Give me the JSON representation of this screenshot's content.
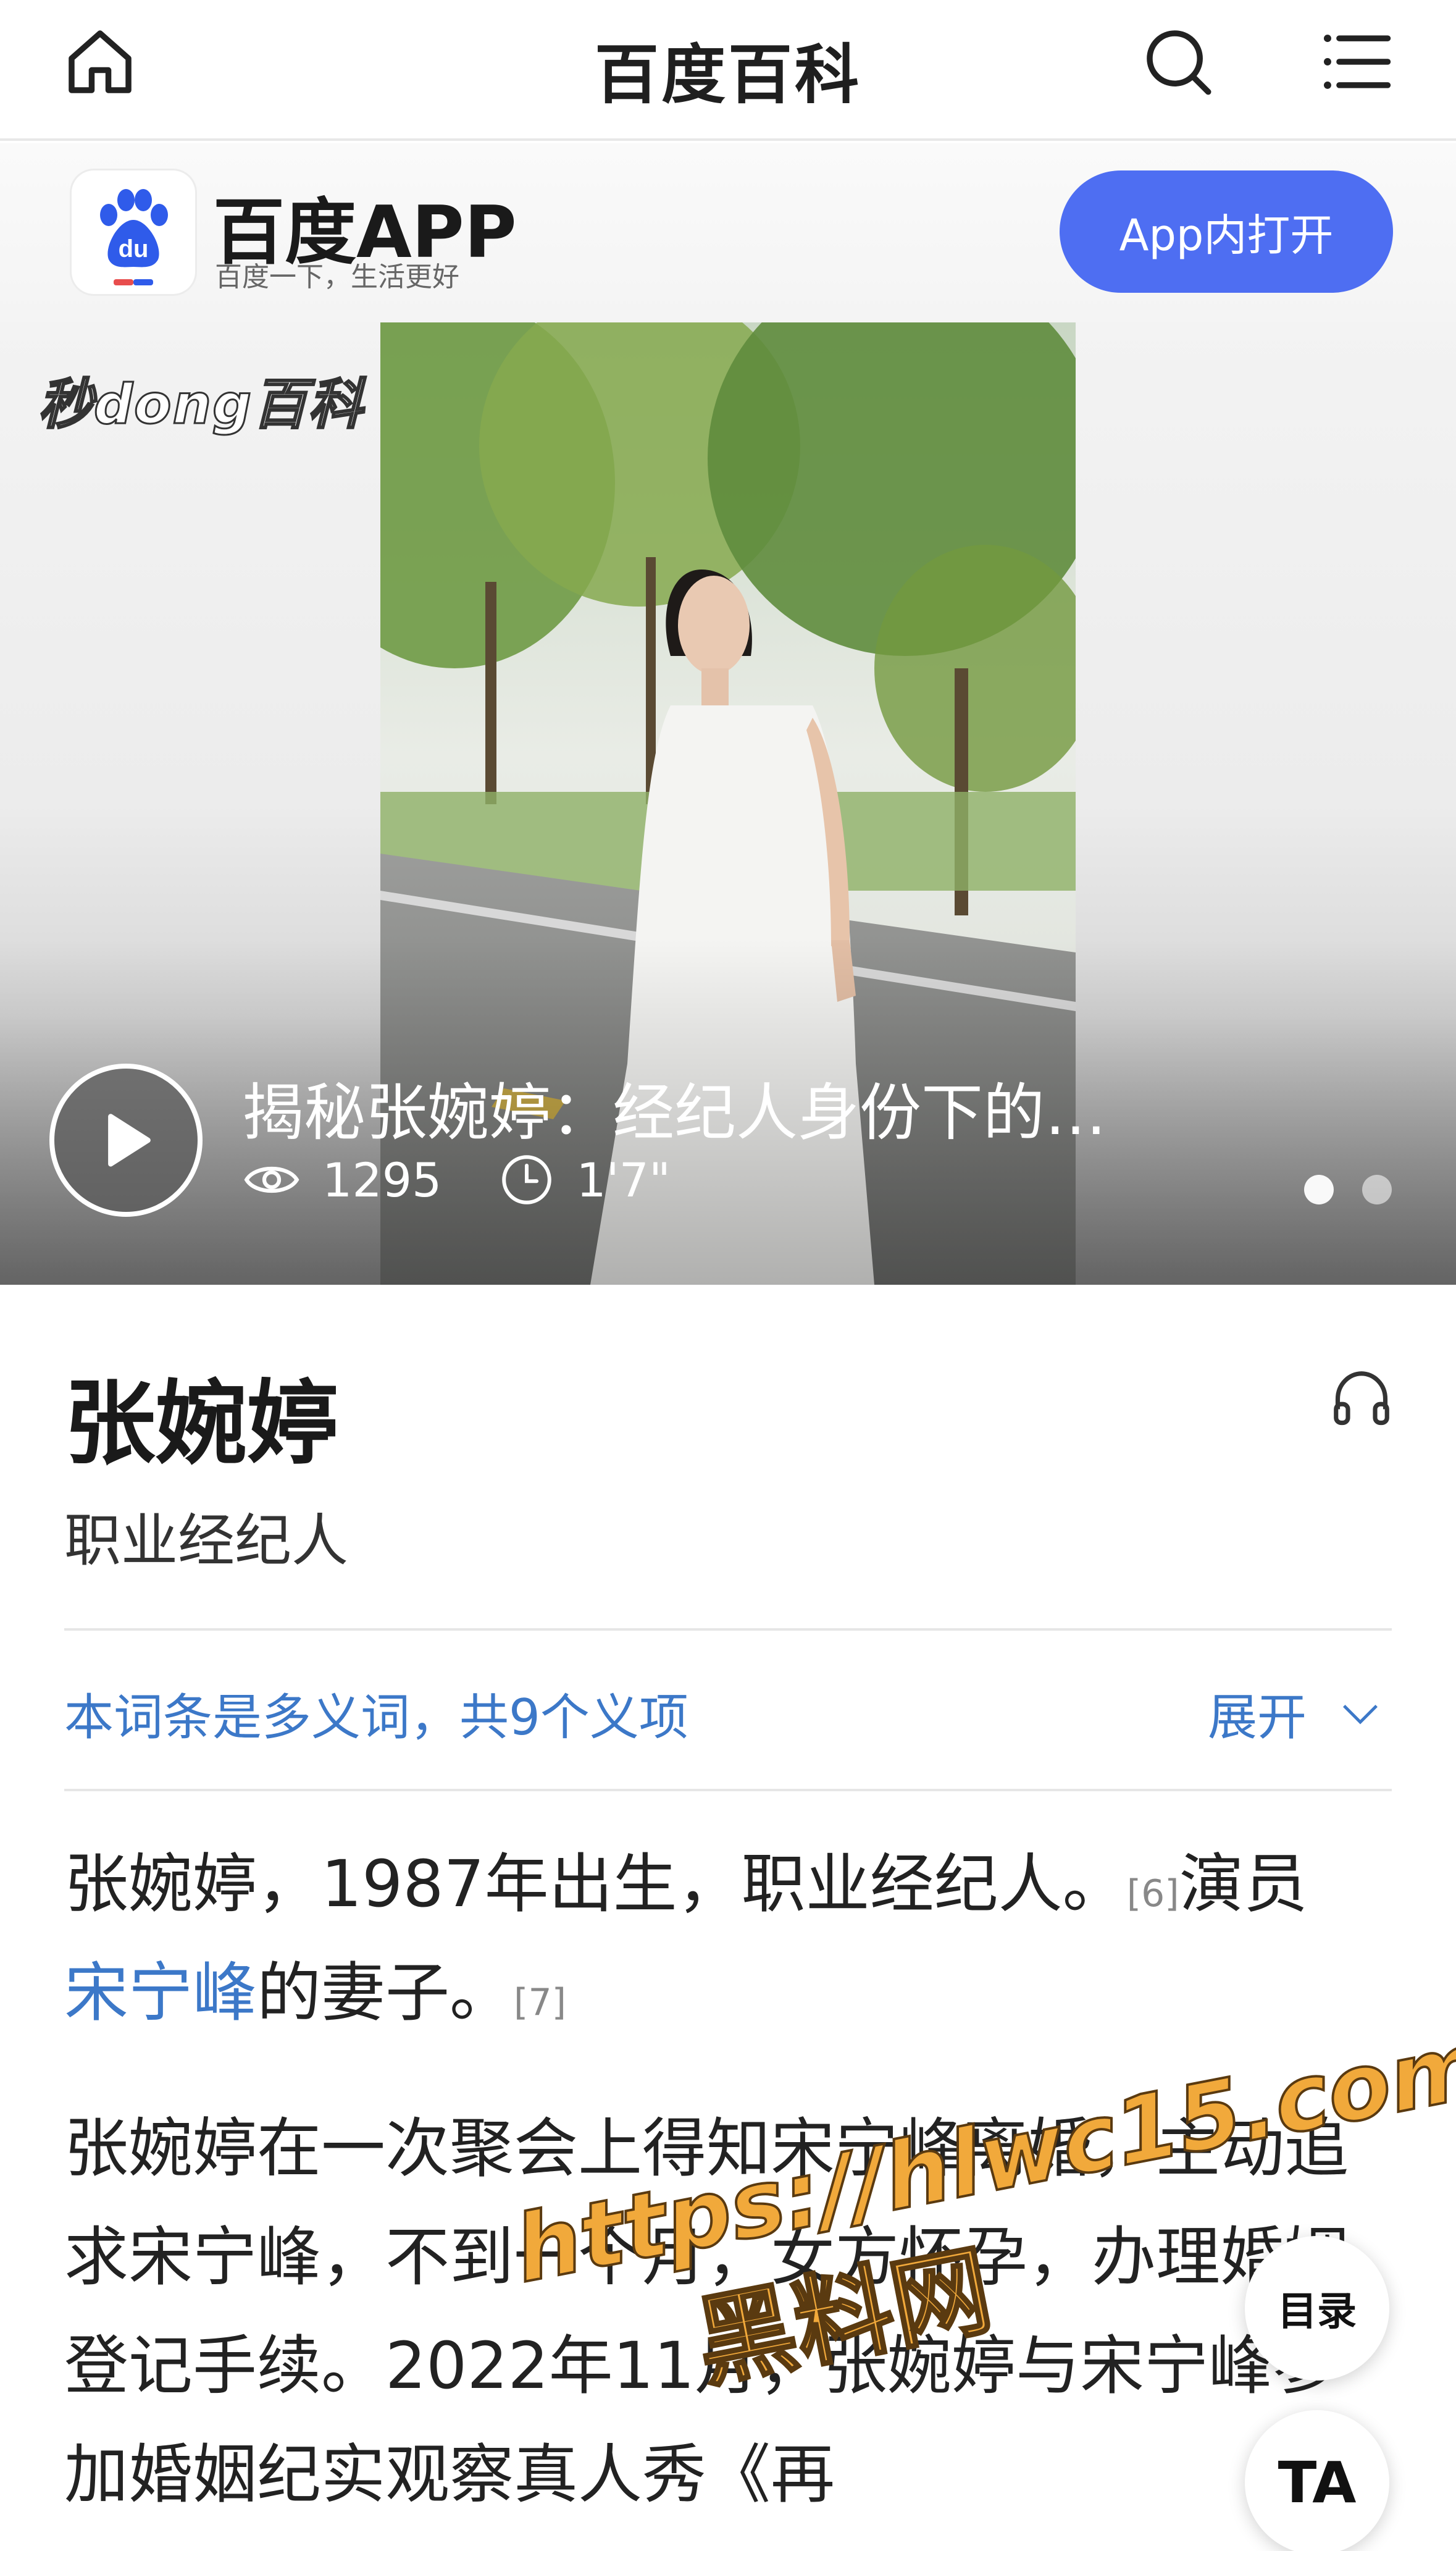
{
  "header": {
    "title": "百度百科"
  },
  "app_banner": {
    "logo_text": "du",
    "name": "百度APP",
    "slogan": "百度一下，生活更好",
    "open_button": "App内打开"
  },
  "video": {
    "brand": "秒dong百科",
    "title": "揭秘张婉婷：经纪人身份下的…",
    "views": "1295",
    "duration": "1'7\"",
    "slide_count": 2,
    "active_slide": 1
  },
  "entry": {
    "name": "张婉婷",
    "subtitle": "职业经纪人",
    "polysemy_text": "本词条是多义词，共9个义项",
    "expand_label": "展开",
    "para1": {
      "text_a": "张婉婷，1987年出生，职业经纪人。",
      "ref_a": "[6]",
      "text_b": "演员",
      "link": "宋宁峰",
      "text_c": "的妻子。",
      "ref_b": "[7]"
    },
    "para2": "张婉婷在一次聚会上得知宋宁峰离婚，主动追求宋宁峰，不到一个月，女方怀孕，办理婚姻登记手续。2022年11月，张婉婷与宋宁峰参加婚姻纪实观察真人秀《再"
  },
  "floating": {
    "toc": "目录",
    "ta": "TA"
  },
  "watermark": {
    "url": "https://hlwc15.com",
    "name": "黑料网"
  },
  "colors": {
    "accent_blue": "#4e6ef2",
    "link_blue": "#3c78c8",
    "watermark_orange": "#f1a93b"
  }
}
